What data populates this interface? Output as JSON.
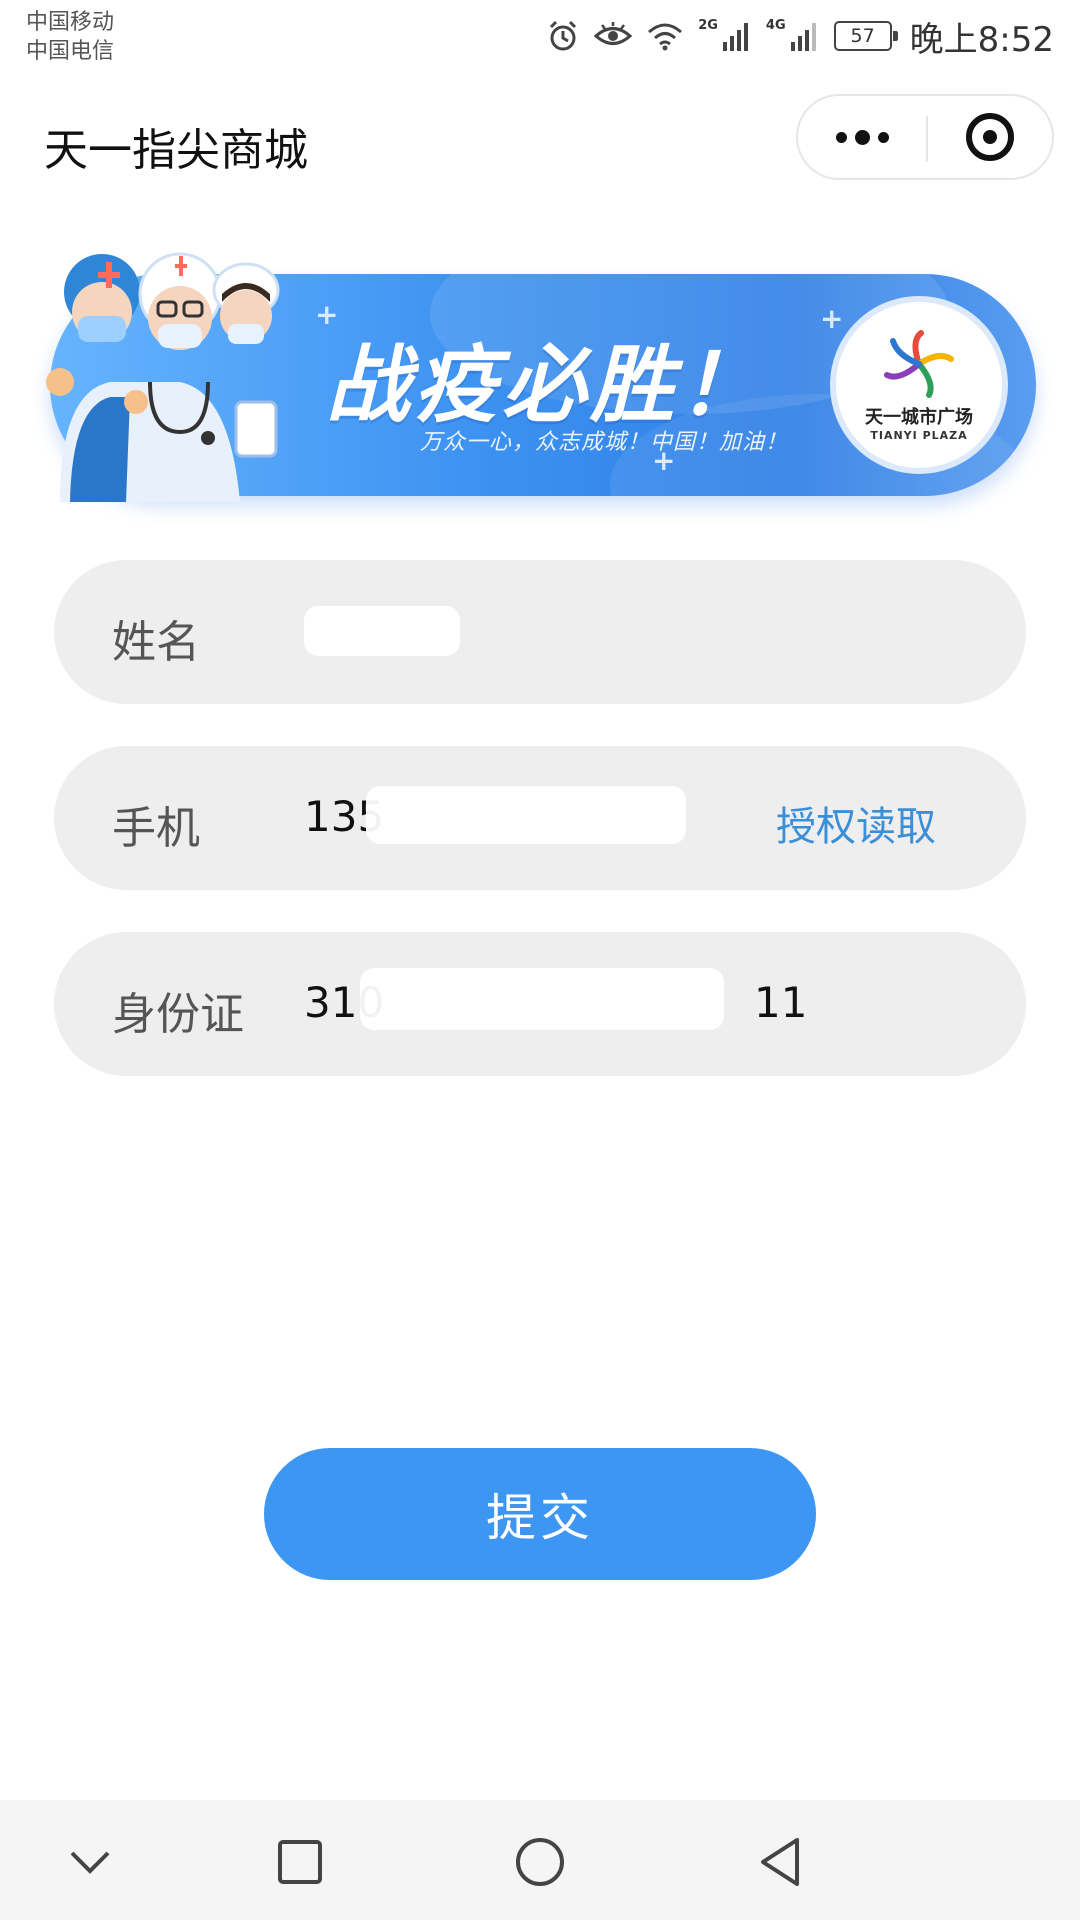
{
  "status_bar": {
    "carrier_1": "中国移动",
    "carrier_2": "中国电信",
    "signal_1_tag": "2G",
    "signal_2_tag": "4G",
    "battery": "57",
    "time": "晚上8:52",
    "icons": [
      "alarm-icon",
      "eye-icon",
      "wifi-icon",
      "signal-icon",
      "signal-icon",
      "battery-icon"
    ]
  },
  "nav": {
    "title": "天一指尖商城",
    "icons": [
      "more-dots-icon",
      "close-target-icon"
    ]
  },
  "banner": {
    "title": "战疫必胜！",
    "subtitle": "万众一心，众志成城！中国！加油！",
    "logo_name": "天一城市广场",
    "logo_en": "TIANYI PLAZA",
    "colors": {
      "start": "#66b4ff",
      "end": "#2f7fe6"
    }
  },
  "form": {
    "name": {
      "label": "姓名",
      "value": ""
    },
    "phone": {
      "label": "手机",
      "value": "135",
      "action": "授权读取"
    },
    "id_card": {
      "label": "身份证",
      "value": "310",
      "value_tail": "11"
    }
  },
  "submit_label": "提交",
  "system_nav": {
    "icons": [
      "chevron-down-icon",
      "recent-apps-icon",
      "home-icon",
      "back-icon"
    ]
  },
  "colors": {
    "accent": "#3d97f2",
    "link": "#3a8fd8",
    "field_bg": "#efeeee"
  }
}
